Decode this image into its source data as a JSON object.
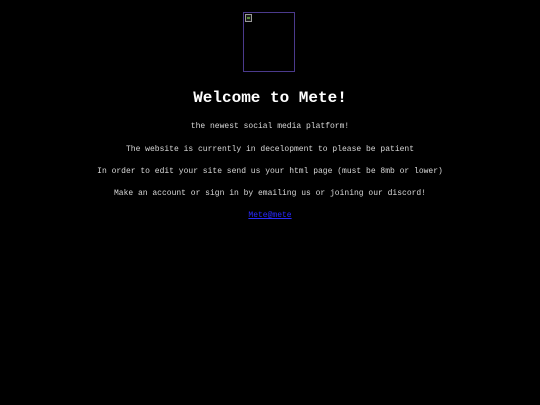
{
  "page": {
    "title": "Welcome to Mete!",
    "lines": [
      "the newest social media platform!",
      "The website is currently in decelopment to please be patient",
      "In order to edit your site send us your html page (must be 8mb or lower)",
      "Make an account or sign in by emailing us or joining our discord!"
    ],
    "link_label": "Mete@mete"
  },
  "icons": {
    "logo": "broken-image-icon"
  },
  "colors": {
    "background": "#000000",
    "text": "#d8d8d8",
    "link": "#2a2aff",
    "logo_border": "#4b3a8c"
  }
}
